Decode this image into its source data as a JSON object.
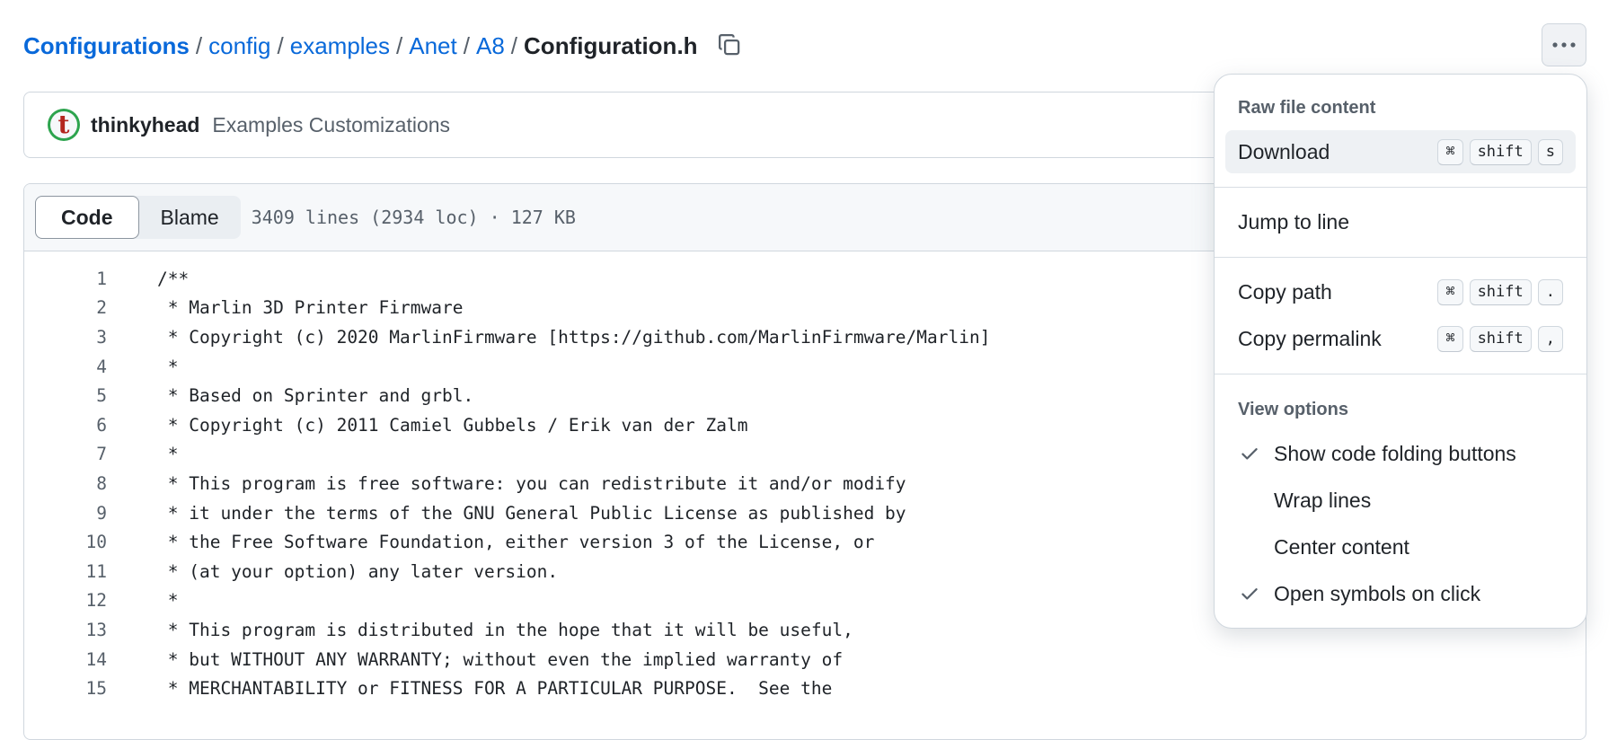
{
  "breadcrumb": {
    "root": "Configurations",
    "parts": [
      "config",
      "examples",
      "Anet",
      "A8"
    ],
    "separator": "/",
    "current": "Configuration.h"
  },
  "commit": {
    "avatar_letter": "t",
    "author": "thinkyhead",
    "message": "Examples Customizations"
  },
  "file": {
    "tabs": [
      "Code",
      "Blame"
    ],
    "active_tab": "Code",
    "meta": "3409 lines (2934 loc) · 127 KB"
  },
  "code_lines": [
    {
      "n": "1",
      "text": "/**"
    },
    {
      "n": "2",
      "text": " * Marlin 3D Printer Firmware"
    },
    {
      "n": "3",
      "text": " * Copyright (c) 2020 MarlinFirmware [https://github.com/MarlinFirmware/Marlin]"
    },
    {
      "n": "4",
      "text": " *"
    },
    {
      "n": "5",
      "text": " * Based on Sprinter and grbl."
    },
    {
      "n": "6",
      "text": " * Copyright (c) 2011 Camiel Gubbels / Erik van der Zalm"
    },
    {
      "n": "7",
      "text": " *"
    },
    {
      "n": "8",
      "text": " * This program is free software: you can redistribute it and/or modify"
    },
    {
      "n": "9",
      "text": " * it under the terms of the GNU General Public License as published by"
    },
    {
      "n": "10",
      "text": " * the Free Software Foundation, either version 3 of the License, or"
    },
    {
      "n": "11",
      "text": " * (at your option) any later version."
    },
    {
      "n": "12",
      "text": " *"
    },
    {
      "n": "13",
      "text": " * This program is distributed in the hope that it will be useful,"
    },
    {
      "n": "14",
      "text": " * but WITHOUT ANY WARRANTY; without even the implied warranty of"
    },
    {
      "n": "15",
      "text": " * MERCHANTABILITY or FITNESS FOR A PARTICULAR PURPOSE.  See the"
    }
  ],
  "menu": {
    "raw_title": "Raw file content",
    "download": {
      "label": "Download",
      "keys": [
        "⌘",
        "shift",
        "s"
      ]
    },
    "jump": {
      "label": "Jump to line"
    },
    "copy_path": {
      "label": "Copy path",
      "keys": [
        "⌘",
        "shift",
        "."
      ]
    },
    "copy_permalink": {
      "label": "Copy permalink",
      "keys": [
        "⌘",
        "shift",
        ","
      ]
    },
    "view_title": "View options",
    "options": [
      {
        "label": "Show code folding buttons",
        "checked": true
      },
      {
        "label": "Wrap lines",
        "checked": false
      },
      {
        "label": "Center content",
        "checked": false
      },
      {
        "label": "Open symbols on click",
        "checked": true
      }
    ]
  },
  "colors": {
    "link": "#0969da",
    "text": "#1f2328",
    "muted": "#57606a",
    "border": "#d0d7de"
  }
}
